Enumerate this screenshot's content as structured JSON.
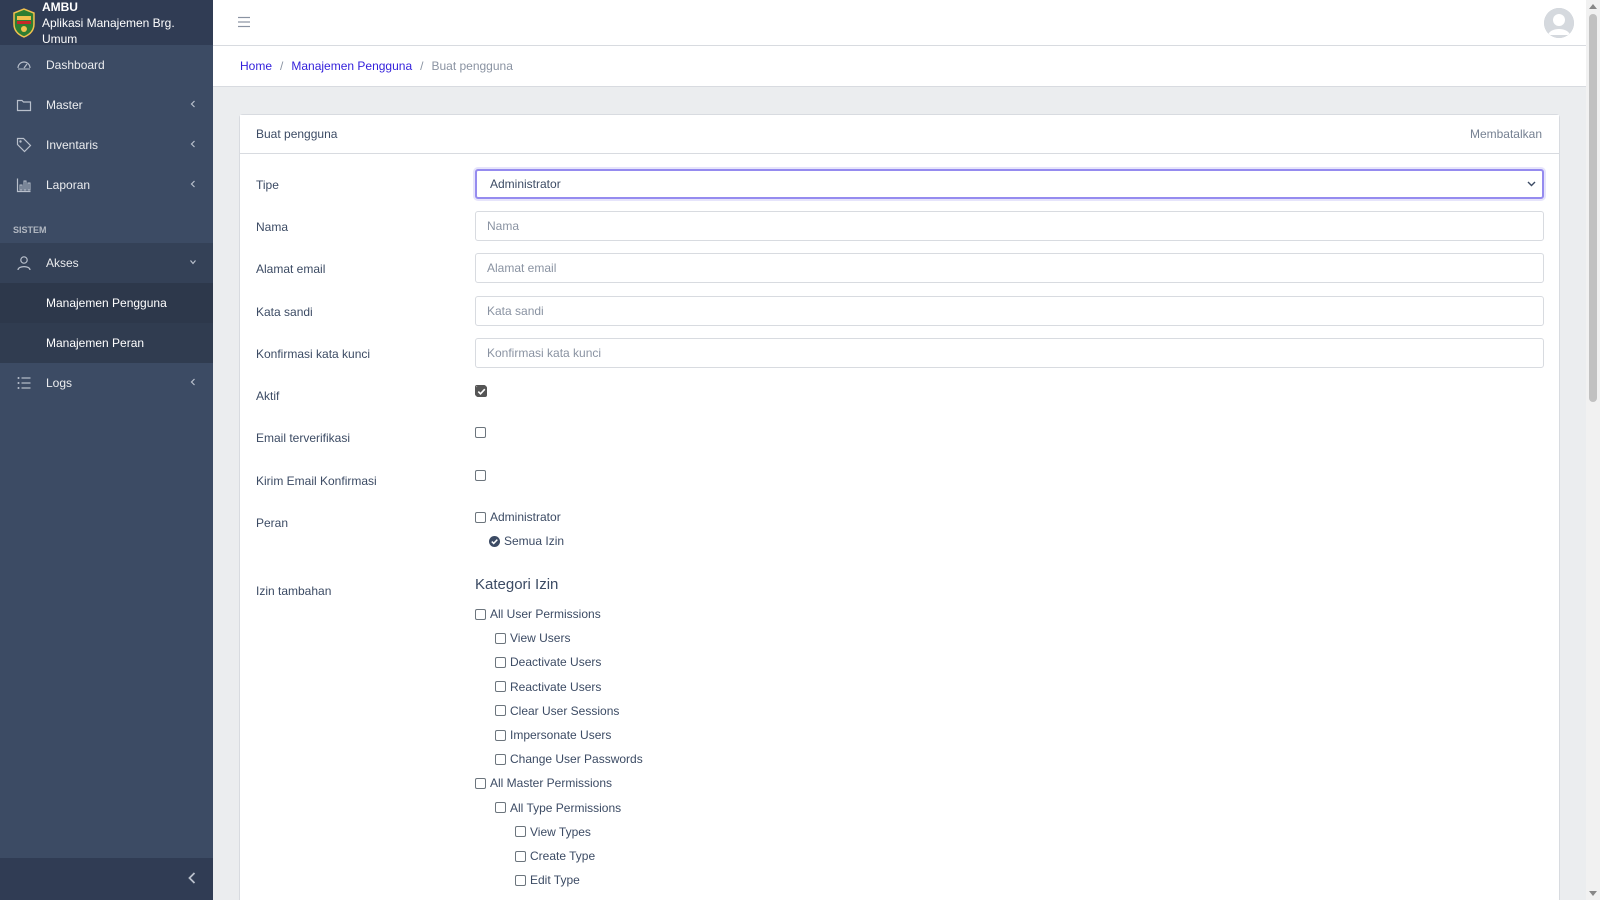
{
  "brand": {
    "title": "AMBU",
    "subtitle": "Aplikasi Manajemen Brg. Umum"
  },
  "sidebar": {
    "items": [
      {
        "label": "Dashboard",
        "icon": "speedometer-icon"
      },
      {
        "label": "Master",
        "icon": "folder-icon"
      },
      {
        "label": "Inventaris",
        "icon": "tag-icon"
      },
      {
        "label": "Laporan",
        "icon": "chart-icon"
      }
    ],
    "section_title": "SISTEM",
    "akses": {
      "label": "Akses",
      "icon": "user-icon"
    },
    "subitems": [
      {
        "label": "Manajemen Pengguna"
      },
      {
        "label": "Manajemen Peran"
      }
    ],
    "logs": {
      "label": "Logs",
      "icon": "list-icon"
    }
  },
  "breadcrumb": {
    "home": "Home",
    "parent": "Manajemen Pengguna",
    "current": "Buat pengguna"
  },
  "card": {
    "title": "Buat pengguna",
    "cancel": "Membatalkan"
  },
  "form": {
    "tipe_label": "Tipe",
    "tipe_value": "Administrator",
    "nama_label": "Nama",
    "nama_placeholder": "Nama",
    "email_label": "Alamat email",
    "email_placeholder": "Alamat email",
    "password_label": "Kata sandi",
    "password_placeholder": "Kata sandi",
    "confirm_label": "Konfirmasi kata kunci",
    "confirm_placeholder": "Konfirmasi kata kunci",
    "aktif_label": "Aktif",
    "aktif_checked": true,
    "verified_label": "Email terverifikasi",
    "verified_checked": false,
    "send_label": "Kirim Email Konfirmasi",
    "send_checked": false,
    "peran_label": "Peran",
    "role_admin": "Administrator",
    "role_all": "Semua Izin",
    "extra_label": "Izin tambahan",
    "category_title": "Kategori Izin"
  },
  "permissions": [
    {
      "label": "All User Permissions",
      "level": 0
    },
    {
      "label": "View Users",
      "level": 1
    },
    {
      "label": "Deactivate Users",
      "level": 1
    },
    {
      "label": "Reactivate Users",
      "level": 1
    },
    {
      "label": "Clear User Sessions",
      "level": 1
    },
    {
      "label": "Impersonate Users",
      "level": 1
    },
    {
      "label": "Change User Passwords",
      "level": 1
    },
    {
      "label": "All Master Permissions",
      "level": 0
    },
    {
      "label": "All Type Permissions",
      "level": 1
    },
    {
      "label": "View Types",
      "level": 2
    },
    {
      "label": "Create Type",
      "level": 2
    },
    {
      "label": "Edit Type",
      "level": 2
    }
  ],
  "colors": {
    "sidebar": "#3c4b64",
    "sidebar_dark": "#303c54",
    "link": "#321fdb",
    "focus": "#958bef"
  }
}
